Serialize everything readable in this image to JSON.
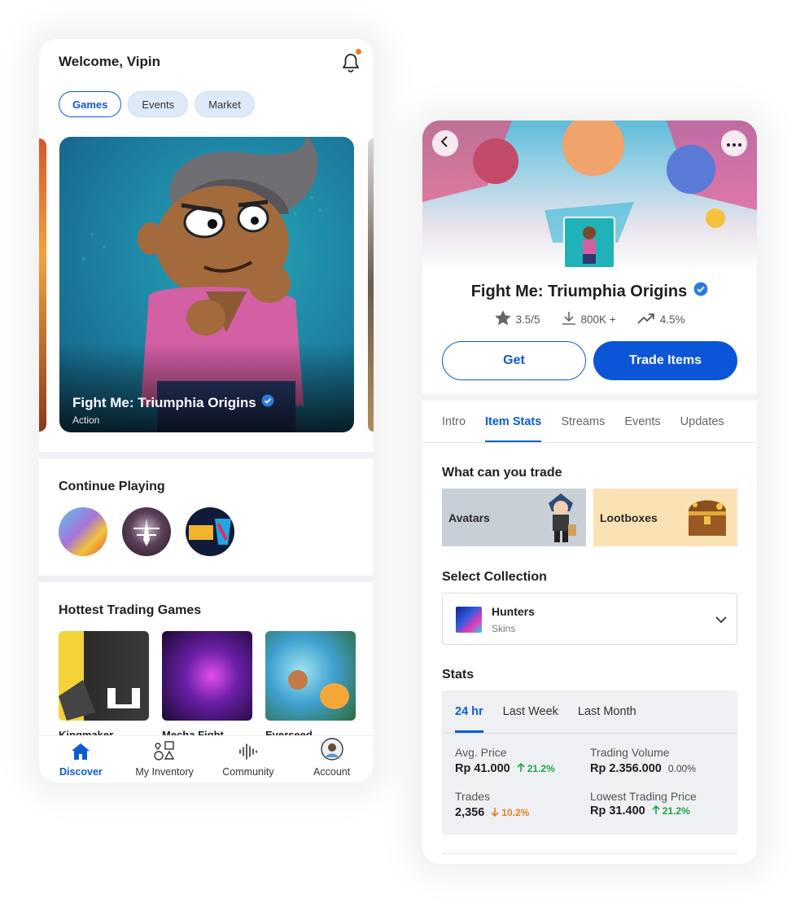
{
  "discover_screen": {
    "greeting": "Welcome, Vipin",
    "chips": [
      "Games",
      "Events",
      "Market"
    ],
    "featured": {
      "title": "Fight Me: Triumphia Origins",
      "genre": "Action"
    },
    "continue_playing": {
      "title": "Continue Playing"
    },
    "hottest": {
      "title": "Hottest Trading Games",
      "games": [
        "Kingmaker",
        "Mecha Fight",
        "Everseed"
      ]
    },
    "tabbar": [
      "Discover",
      "My Inventory",
      "Community",
      "Account"
    ]
  },
  "game_screen": {
    "title": "Fight Me: Triumphia Origins",
    "rating": "3.5/5",
    "downloads": "800K +",
    "trend": "4.5%",
    "get_label": "Get",
    "trade_label": "Trade Items",
    "tabs": [
      "Intro",
      "Item Stats",
      "Streams",
      "Events",
      "Updates"
    ],
    "trade_section": {
      "title": "What can you trade",
      "items": [
        "Avatars",
        "Lootboxes"
      ]
    },
    "collection": {
      "title": "Select Collection",
      "selected_name": "Hunters",
      "selected_type": "Skins"
    },
    "stats": {
      "title": "Stats",
      "tabs": [
        "24 hr",
        "Last Week",
        "Last Month"
      ],
      "avg_price": {
        "label": "Avg. Price",
        "value": "Rp 41.000",
        "change": "21.2%"
      },
      "trading_volume": {
        "label": "Trading Volume",
        "value": "Rp 2.356.000",
        "change": "0.00%"
      },
      "trades": {
        "label": "Trades",
        "value": "2,356",
        "change": "10.2%"
      },
      "lowest_price": {
        "label": "Lowest Trading Price",
        "value": "Rp 31.400",
        "change": "21.2%"
      }
    }
  },
  "colors": {
    "accent": "#0b5bd3",
    "up": "#1fa34a",
    "down": "#e0821c",
    "notification": "#f07a1a"
  }
}
